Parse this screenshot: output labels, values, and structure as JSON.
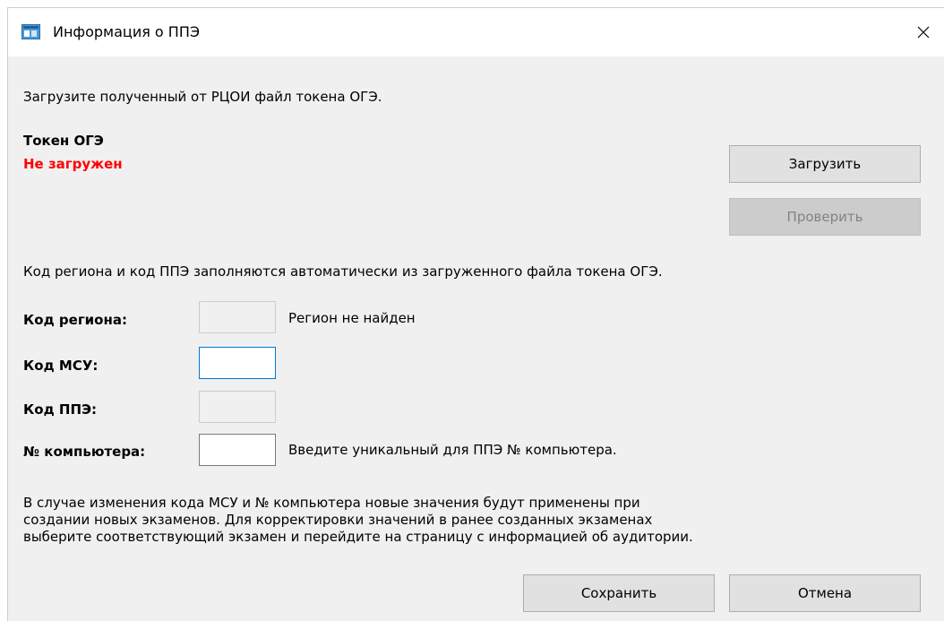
{
  "window": {
    "title": "Информация о ППЭ",
    "close_glyph": "✕"
  },
  "intro": "Загрузите полученный от РЦОИ файл токена ОГЭ.",
  "token": {
    "label": "Токен ОГЭ",
    "status": "Не загружен",
    "status_color": "#ff0000"
  },
  "buttons": {
    "load": "Загрузить",
    "check": "Проверить",
    "save": "Сохранить",
    "cancel": "Отмена"
  },
  "auto_note": "Код региона и код ППЭ заполняются автоматически из загруженного файла токена ОГЭ.",
  "fields": {
    "region": {
      "label": "Код региона:",
      "value": "",
      "hint": "Регион не найден"
    },
    "msu": {
      "label": "Код МСУ:",
      "value": ""
    },
    "ppe": {
      "label": "Код ППЭ:",
      "value": ""
    },
    "computer": {
      "label": "№ компьютера:",
      "value": "",
      "hint": "Введите уникальный для ППЭ № компьютера."
    }
  },
  "info_lines": [
    "В случае изменения кода МСУ и № компьютера новые значения будут применены при",
    "создании новых экзаменов. Для корректировки значений в ранее созданных экзаменах",
    "выберите соответствующий экзамен и перейдите на страницу с информацией об аудитории."
  ],
  "icons": {
    "app": "app-window-icon",
    "close": "close-icon"
  },
  "colors": {
    "accent": "#0078d7",
    "dialog_bg": "#f0f0f0",
    "button_bg": "#e1e1e1"
  }
}
